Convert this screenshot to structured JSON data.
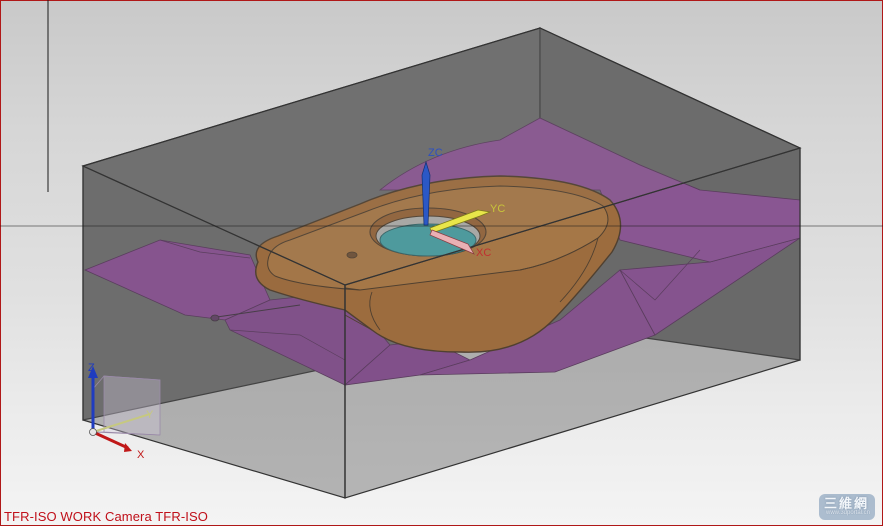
{
  "view": {
    "label": "TFR-ISO WORK Camera TFR-ISO",
    "label_color": "#c0101a"
  },
  "wcs": {
    "zc": "ZC",
    "yc": "YC",
    "xc": "XC"
  },
  "triad": {
    "z": "Z",
    "y": "Y",
    "x": "X"
  },
  "watermark": {
    "title": "三維網",
    "url": "www.3dportal.cn"
  },
  "colors": {
    "part": "#c8782c",
    "parting_surface": "#a64fb4",
    "workpiece_box": "#5f5f5f",
    "hole": "#3cc6cc",
    "crosshair": "#1a1a1a"
  }
}
